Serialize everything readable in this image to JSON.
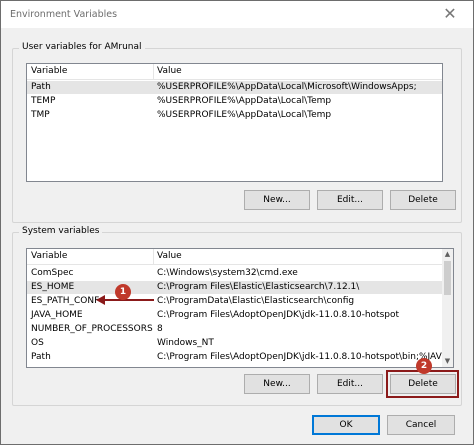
{
  "window": {
    "title": "Environment Variables"
  },
  "user_vars": {
    "group_label": "User variables for AMrunal",
    "columns": [
      "Variable",
      "Value"
    ],
    "rows": [
      {
        "variable": "Path",
        "value": "%USERPROFILE%\\AppData\\Local\\Microsoft\\WindowsApps;"
      },
      {
        "variable": "TEMP",
        "value": "%USERPROFILE%\\AppData\\Local\\Temp"
      },
      {
        "variable": "TMP",
        "value": "%USERPROFILE%\\AppData\\Local\\Temp"
      }
    ],
    "buttons": {
      "new": "New...",
      "edit": "Edit...",
      "delete": "Delete"
    }
  },
  "system_vars": {
    "group_label": "System variables",
    "columns": [
      "Variable",
      "Value"
    ],
    "rows": [
      {
        "variable": "ComSpec",
        "value": "C:\\Windows\\system32\\cmd.exe"
      },
      {
        "variable": "ES_HOME",
        "value": "C:\\Program Files\\Elastic\\Elasticsearch\\7.12.1\\"
      },
      {
        "variable": "ES_PATH_CONF",
        "value": "C:\\ProgramData\\Elastic\\Elasticsearch\\config"
      },
      {
        "variable": "JAVA_HOME",
        "value": "C:\\Program Files\\AdoptOpenJDK\\jdk-11.0.8.10-hotspot"
      },
      {
        "variable": "NUMBER_OF_PROCESSORS",
        "value": "8"
      },
      {
        "variable": "OS",
        "value": "Windows_NT"
      },
      {
        "variable": "Path",
        "value": "C:\\Program Files\\AdoptOpenJDK\\jdk-11.0.8.10-hotspot\\bin;%JAV"
      }
    ],
    "buttons": {
      "new": "New...",
      "edit": "Edit...",
      "delete": "Delete"
    }
  },
  "dialog_buttons": {
    "ok": "OK",
    "cancel": "Cancel"
  },
  "annotations": {
    "step1": "1",
    "step2": "2",
    "color": "#c0392b"
  }
}
